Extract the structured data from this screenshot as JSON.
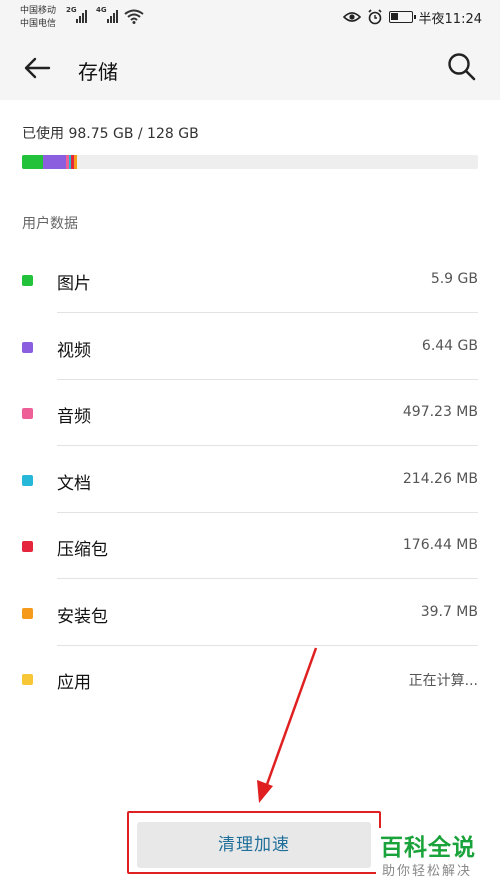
{
  "status": {
    "carrier1": "中国移动",
    "carrier2": "中国电信",
    "net1": "2G",
    "net2": "4G",
    "time": "半夜11:24",
    "icons": [
      "eye-comfort-icon",
      "alarm-icon",
      "battery-icon",
      "wifi-icon",
      "signal-icon"
    ]
  },
  "header": {
    "title": "存储",
    "back_icon": "back-arrow-icon",
    "search_icon": "search-icon"
  },
  "storage": {
    "used_label": "已使用 98.75 GB / 128 GB",
    "used_gb": 98.75,
    "total_gb": 128
  },
  "section_title": "用户数据",
  "items": [
    {
      "label": "图片",
      "size": "5.9 GB",
      "color": "#22c33a"
    },
    {
      "label": "视频",
      "size": "6.44 GB",
      "color": "#8b5ee0"
    },
    {
      "label": "音频",
      "size": "497.23 MB",
      "color": "#ef5f97"
    },
    {
      "label": "文档",
      "size": "214.26 MB",
      "color": "#27b7d8"
    },
    {
      "label": "压缩包",
      "size": "176.44 MB",
      "color": "#e5253c"
    },
    {
      "label": "安装包",
      "size": "39.7 MB",
      "color": "#f59a1b"
    },
    {
      "label": "应用",
      "size": "正在计算...",
      "color": "#f8c737"
    }
  ],
  "clean_button": "清理加速",
  "watermark": {
    "title": "百科全说",
    "subtitle": "助你轻松解决"
  },
  "colors": {
    "highlight": "#e02020",
    "button_text": "#1f6f9a"
  }
}
